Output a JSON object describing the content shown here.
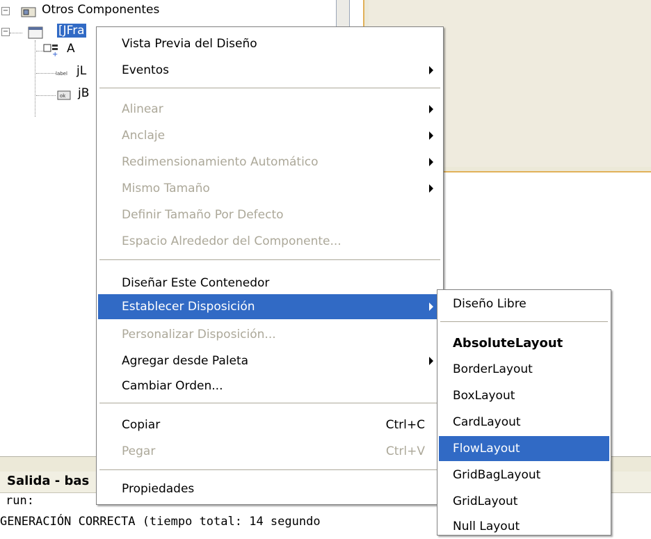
{
  "tree": {
    "items": [
      {
        "label": "Otros Componentes",
        "icon": "container-icon"
      },
      {
        "label": "[JFra",
        "icon": "jframe-icon"
      },
      {
        "label": "A",
        "icon": "absolute-layout-icon"
      },
      {
        "label": "jL",
        "icon": "label-icon"
      },
      {
        "label": "jB",
        "icon": "button-icon"
      }
    ]
  },
  "context_menu": {
    "items": [
      {
        "label": "Vista Previa del Diseño",
        "enabled": true
      },
      {
        "label": "Eventos",
        "enabled": true,
        "submenu": true
      },
      {
        "label": "Alinear",
        "enabled": false,
        "submenu": true
      },
      {
        "label": "Anclaje",
        "enabled": false,
        "submenu": true
      },
      {
        "label": "Redimensionamiento Automático",
        "enabled": false,
        "submenu": true
      },
      {
        "label": "Mismo Tamaño",
        "enabled": false,
        "submenu": true
      },
      {
        "label": "Definir Tamaño Por Defecto",
        "enabled": false
      },
      {
        "label": "Espacio Alrededor del Componente...",
        "enabled": false
      },
      {
        "label": "Diseñar Este Contenedor",
        "enabled": true
      },
      {
        "label": "Establecer Disposición",
        "enabled": true,
        "submenu": true,
        "highlighted": true
      },
      {
        "label": "Personalizar Disposición...",
        "enabled": false
      },
      {
        "label": "Agregar desde Paleta",
        "enabled": true,
        "submenu": true
      },
      {
        "label": "Cambiar Orden...",
        "enabled": true
      },
      {
        "label": "Copiar",
        "enabled": true,
        "shortcut": "Ctrl+C"
      },
      {
        "label": "Pegar",
        "enabled": false,
        "shortcut": "Ctrl+V"
      },
      {
        "label": "Propiedades",
        "enabled": true
      }
    ]
  },
  "layout_submenu": {
    "items": [
      {
        "label": "Diseño Libre"
      },
      {
        "label": "AbsoluteLayout",
        "current": true
      },
      {
        "label": "BorderLayout"
      },
      {
        "label": "BoxLayout"
      },
      {
        "label": "CardLayout"
      },
      {
        "label": "FlowLayout",
        "highlighted": true
      },
      {
        "label": "GridBagLayout"
      },
      {
        "label": "GridLayout"
      },
      {
        "label": "Null Layout"
      }
    ]
  },
  "output": {
    "title": "Salida - bas",
    "lines": [
      "run:",
      "GENERACIÓN CORRECTA (tiempo total: 14 segundo"
    ]
  },
  "colors": {
    "highlight": "#316ac5",
    "disabled_text": "#aca899",
    "design_border": "#e1b158"
  }
}
